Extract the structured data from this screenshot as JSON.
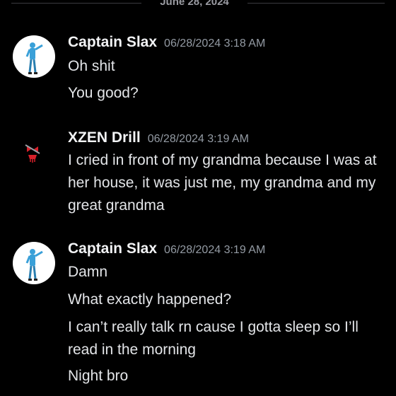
{
  "date_divider": "June 28, 2024",
  "messages": [
    {
      "username": "Captain Slax",
      "timestamp": "06/28/2024 3:18 AM",
      "avatar": "astronaut-avatar",
      "lines": [
        "Oh shit",
        "You good?"
      ]
    },
    {
      "username": "XZEN Drill",
      "timestamp": "06/28/2024 3:19 AM",
      "avatar": "red-skull-avatar",
      "lines": [
        "I cried in front of my grandma because I was at her house, it was just me, my grandma and my great grandma"
      ]
    },
    {
      "username": "Captain Slax",
      "timestamp": "06/28/2024 3:19 AM",
      "avatar": "astronaut-avatar",
      "lines": [
        "Damn",
        "What exactly happened?",
        "I can’t really talk rn cause I gotta sleep so I’ll read in the morning",
        "Night bro"
      ]
    }
  ],
  "colors": {
    "background": "#000000",
    "username": "#f2f3f5",
    "timestamp": "#949ba4",
    "text": "#e3e5e8",
    "accent_blue": "#3aa0d8",
    "accent_red": "#d8202a"
  }
}
